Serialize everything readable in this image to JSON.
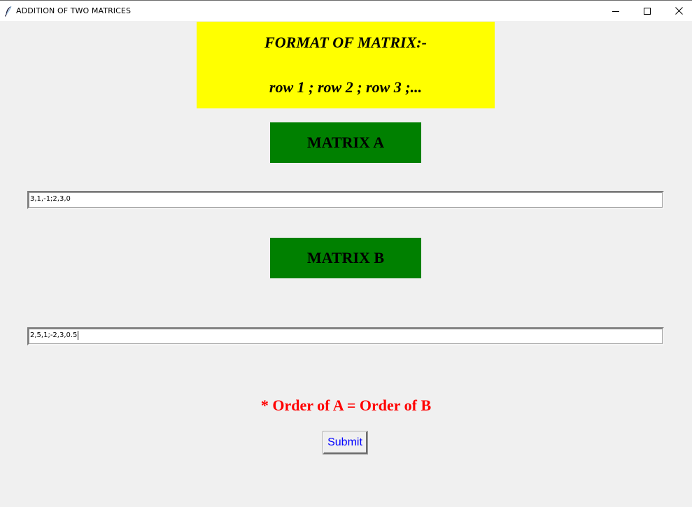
{
  "window": {
    "title": "ADDITION OF TWO MATRICES",
    "app_icon": "feather-icon",
    "controls": {
      "minimize_icon": "minimize-icon",
      "maximize_icon": "maximize-icon",
      "close_icon": "close-icon"
    }
  },
  "format_banner": {
    "line1": "FORMAT OF MATRIX:-",
    "line2": "row 1 ; row 2 ; row 3 ;...",
    "background": "#ffff00"
  },
  "matrix_a": {
    "label": "MATRIX A",
    "value": "3,1,-1;2,3,0",
    "label_background": "#008000"
  },
  "matrix_b": {
    "label": "MATRIX B",
    "value": "2,5,1;-2,3,0.5",
    "label_background": "#008000"
  },
  "note": {
    "text": "* Order of A = Order of B",
    "color": "#ff0000"
  },
  "submit": {
    "label": "Submit",
    "color": "#0000ff"
  }
}
